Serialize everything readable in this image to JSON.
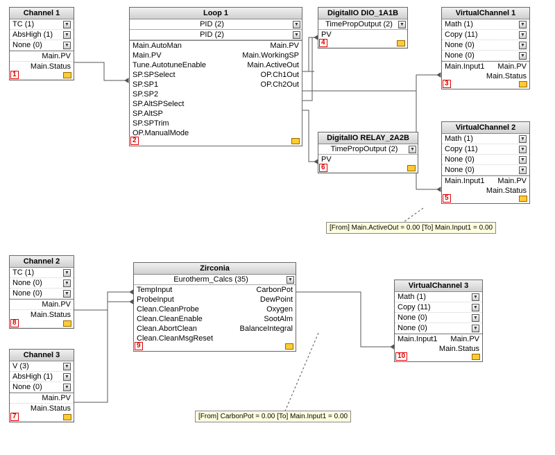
{
  "blocks": {
    "channel1": {
      "title": "Channel 1",
      "rows": [
        "TC (1)",
        "AbsHigh (1)",
        "None (0)"
      ],
      "outs": [
        "Main.PV",
        "Main.Status"
      ],
      "tag": "1"
    },
    "loop1": {
      "title": "Loop 1",
      "subs": [
        "PID (2)",
        "PID (2)"
      ],
      "left": [
        "Main.AutoMan",
        "Main.PV",
        "Tune.AutotuneEnable",
        "SP.SPSelect",
        "SP.SP1",
        "SP.SP2",
        "SP.AltSPSelect",
        "SP.AltSP",
        "SP.SPTrim",
        "OP.ManualMode"
      ],
      "right": [
        "Main.PV",
        "Main.WorkingSP",
        "Main.ActiveOut",
        "OP.Ch1Out",
        "OP.Ch2Out"
      ],
      "tag": "2"
    },
    "dio1": {
      "title": "DigitalIO DIO_1A1B",
      "sub": "TimePropOutput (2)",
      "in": "PV",
      "tag": "4"
    },
    "dio2": {
      "title": "DigitalIO RELAY_2A2B",
      "sub": "TimePropOutput (2)",
      "in": "PV",
      "tag": "6"
    },
    "vc1": {
      "title": "VirtualChannel 1",
      "rows": [
        "Math (1)",
        "Copy (11)",
        "None (0)",
        "None (0)"
      ],
      "inL": "Main.Input1",
      "inR": "Main.PV",
      "outR": "Main.Status",
      "tag": "3"
    },
    "vc2": {
      "title": "VirtualChannel 2",
      "rows": [
        "Math (1)",
        "Copy (11)",
        "None (0)",
        "None (0)"
      ],
      "inL": "Main.Input1",
      "inR": "Main.PV",
      "outR": "Main.Status",
      "tag": "5"
    },
    "vc3": {
      "title": "VirtualChannel 3",
      "rows": [
        "Math (1)",
        "Copy (11)",
        "None (0)",
        "None (0)"
      ],
      "inL": "Main.Input1",
      "inR": "Main.PV",
      "outR": "Main.Status",
      "tag": "10"
    },
    "channel2": {
      "title": "Channel 2",
      "rows": [
        "TC (1)",
        "None (0)",
        "None (0)"
      ],
      "outs": [
        "Main.PV",
        "Main.Status"
      ],
      "tag": "8"
    },
    "channel3": {
      "title": "Channel 3",
      "rows": [
        "V (3)",
        "AbsHigh (1)",
        "None (0)"
      ],
      "outs": [
        "Main.PV",
        "Main.Status"
      ],
      "tag": "7"
    },
    "zirconia": {
      "title": "Zirconia",
      "sub": "Eurotherm_Calcs (35)",
      "left": [
        "TempInput",
        "ProbeInput",
        "Clean.CleanProbe",
        "Clean.CleanEnable",
        "Clean.AbortClean",
        "Clean.CleanMsgReset"
      ],
      "right": [
        "CarbonPot",
        "DewPoint",
        "Oxygen",
        "SootAlm",
        "BalanceIntegral"
      ],
      "tag": "9"
    }
  },
  "tooltips": {
    "t1": "[From]  Main.ActiveOut = 0.00   [To]  Main.Input1 = 0.00",
    "t2": "[From]  CarbonPot = 0.00   [To]  Main.Input1 = 0.00"
  }
}
